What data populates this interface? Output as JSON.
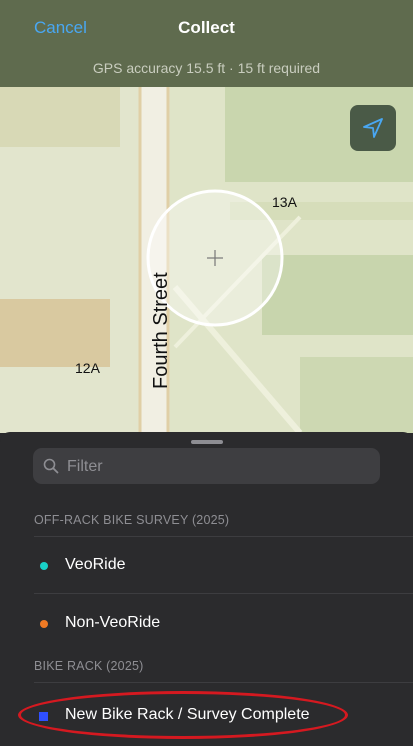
{
  "header": {
    "cancel_label": "Cancel",
    "title": "Collect",
    "gps_status": "GPS accuracy 15.5 ft  ·  15 ft required"
  },
  "map": {
    "labels": {
      "parcel_13a": "13A",
      "parcel_12a": "12A",
      "street": "Fourth Street"
    }
  },
  "sheet": {
    "filter_placeholder": "Filter",
    "sections": [
      {
        "title": "OFF-RACK BIKE SURVEY (2025)",
        "items": [
          {
            "label": "VeoRide",
            "symbol_color": "#19d1c8"
          },
          {
            "label": "Non-VeoRide",
            "symbol_color": "#f07a24"
          }
        ]
      },
      {
        "title": "BIKE RACK (2025)",
        "items": [
          {
            "label": "New Bike Rack / Survey Complete",
            "symbol_color": "#2f4fff"
          }
        ]
      }
    ]
  },
  "colors": {
    "accent": "#49a7f2",
    "annotation": "#d51920"
  }
}
